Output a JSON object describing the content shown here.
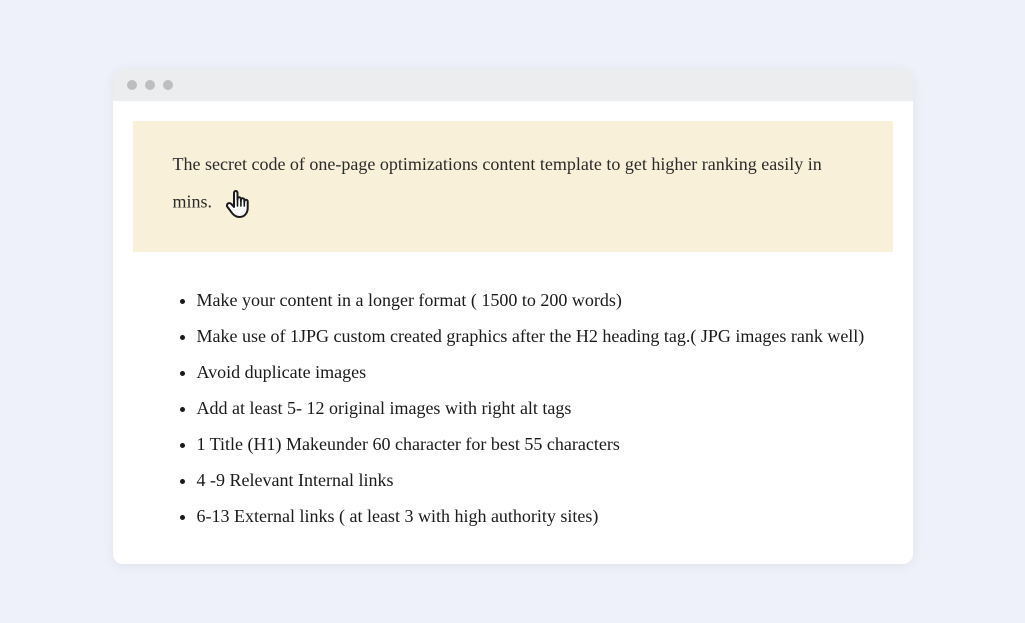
{
  "banner": {
    "text": "The secret code of one-page optimizations content template to get higher ranking easily in mins."
  },
  "tips": [
    "Make your content in a longer format ( 1500 to 200 words)",
    "Make use of 1JPG custom created graphics after the H2 heading tag.( JPG images rank well)",
    "Avoid duplicate images",
    "Add at least 5- 12 original images with right alt tags",
    "1 Title (H1) Makeunder 60 character for best 55 characters",
    "4 -9 Relevant Internal links",
    "6-13 External links ( at least 3 with high authority sites)"
  ]
}
